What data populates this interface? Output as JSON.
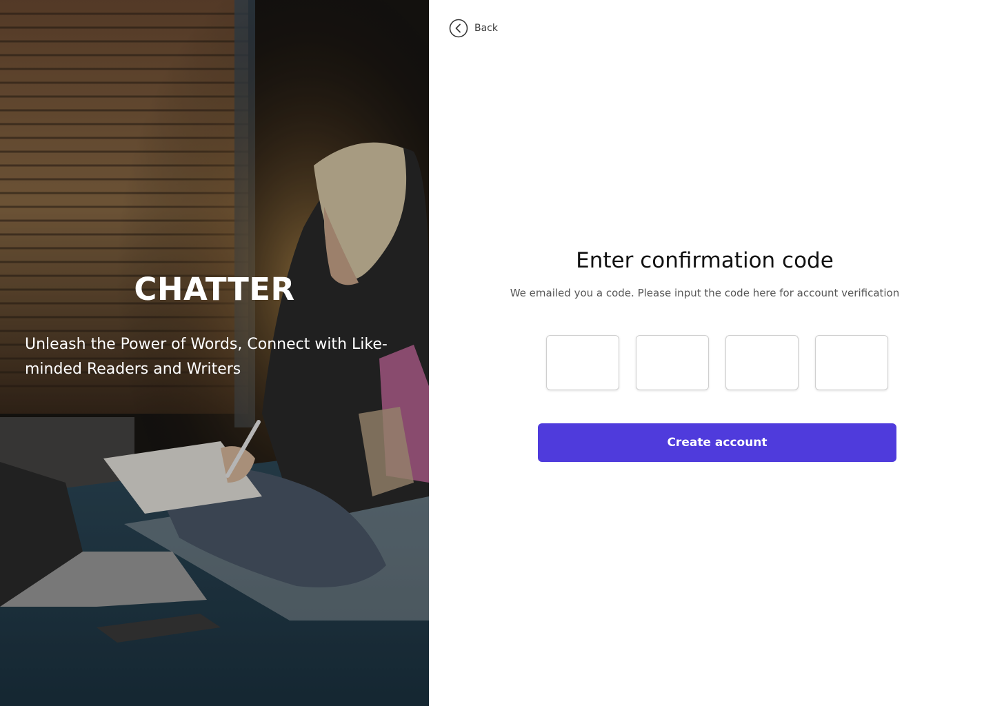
{
  "hero": {
    "brand": "CHATTER",
    "tagline": "Unleash the Power of Words, Connect with Like-minded Readers and Writers",
    "image_icon": "photo-woman-writing-on-bed"
  },
  "nav": {
    "back_label": "Back",
    "back_icon": "chevron-left-circle-icon"
  },
  "form": {
    "title": "Enter confirmation code",
    "subtitle": "We emailed you a code. Please input the code here for account verification",
    "code_inputs": [
      {
        "value": ""
      },
      {
        "value": ""
      },
      {
        "value": ""
      },
      {
        "value": ""
      }
    ],
    "submit_label": "Create account"
  },
  "colors": {
    "accent": "#4f3bdc",
    "input_border": "#cfcfcf",
    "title_text": "#111111",
    "subtitle_text": "#555555"
  }
}
